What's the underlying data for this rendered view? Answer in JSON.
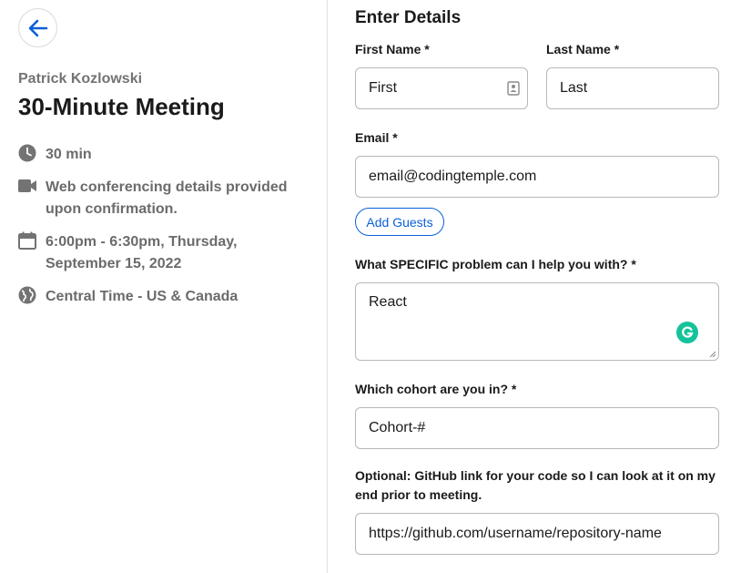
{
  "left": {
    "host_name": "Patrick Kozlowski",
    "event_title": "30-Minute Meeting",
    "duration": "30 min",
    "conferencing_line1": "Web conferencing details provided",
    "conferencing_line2": "upon confirmation.",
    "datetime_line1": "6:00pm - 6:30pm, Thursday,",
    "datetime_line2": "September 15, 2022",
    "timezone": "Central Time - US & Canada"
  },
  "form": {
    "title": "Enter Details",
    "first_name_label": "First Name *",
    "first_name_value": "First",
    "last_name_label": "Last Name *",
    "last_name_value": "Last",
    "email_label": "Email *",
    "email_value": "email@codingtemple.com",
    "add_guests_label": "Add Guests",
    "problem_label": "What SPECIFIC problem can I help you with? *",
    "problem_value": "React",
    "cohort_label": "Which cohort are you in? *",
    "cohort_value": "Cohort-#",
    "github_label_line1": "Optional: GitHub link for your code so I can look at it on my",
    "github_label_line2": "end prior to meeting.",
    "github_value": "https://github.com/username/repository-name"
  },
  "colors": {
    "accent": "#0a5fd8",
    "grammarly": "#15c39a"
  },
  "icons": [
    "back-arrow-icon",
    "clock-icon",
    "video-camera-icon",
    "calendar-icon",
    "globe-icon",
    "contact-card-icon",
    "grammarly-icon"
  ]
}
